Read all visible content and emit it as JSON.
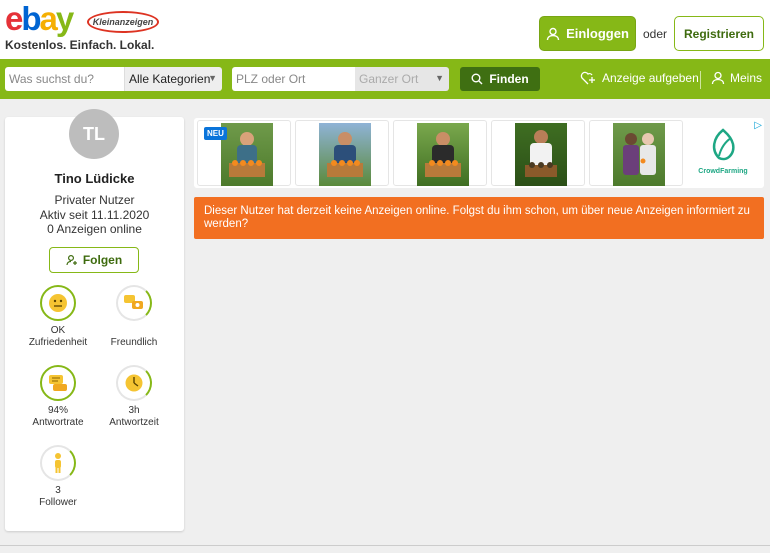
{
  "header": {
    "logo_brand": "ebay",
    "logo_sub": "Kleinanzeigen",
    "tagline": "Kostenlos. Einfach. Lokal.",
    "login_label": "Einloggen",
    "or_label": "oder",
    "register_label": "Registrieren"
  },
  "search": {
    "what_placeholder": "Was suchst du?",
    "category_value": "Alle Kategorien",
    "location_placeholder": "PLZ oder Ort",
    "radius_value": "Ganzer Ort",
    "find_label": "Finden",
    "post_ad_label": "Anzeige aufgeben",
    "mine_label": "Meins"
  },
  "profile": {
    "initials": "TL",
    "name": "Tino Lüdicke",
    "type": "Privater Nutzer",
    "active_since": "Aktiv seit 11.11.2020",
    "ads_online": "0 Anzeigen online",
    "follow_label": "Folgen",
    "badges": [
      {
        "value": "OK",
        "label": "Zufriedenheit",
        "icon": "neutral-face-icon"
      },
      {
        "value": "",
        "label": "Freundlich",
        "icon": "speech-bubbles-icon"
      },
      {
        "value": "94%",
        "label": "Antwortrate",
        "icon": "chat-icon"
      },
      {
        "value": "3h",
        "label": "Antwortzeit",
        "icon": "clock-icon"
      },
      {
        "value": "3",
        "label": "Follower",
        "icon": "person-icon"
      }
    ]
  },
  "ad": {
    "new_badge": "NEU",
    "brand": "CrowdFarming"
  },
  "notice": {
    "text": "Dieser Nutzer hat derzeit keine Anzeigen online. Folgst du ihm schon, um über neue Anzeigen informiert zu werden?"
  },
  "colors": {
    "brand_green": "#86b817",
    "dark_green": "#3f6f12",
    "notice_orange": "#f26f21"
  }
}
